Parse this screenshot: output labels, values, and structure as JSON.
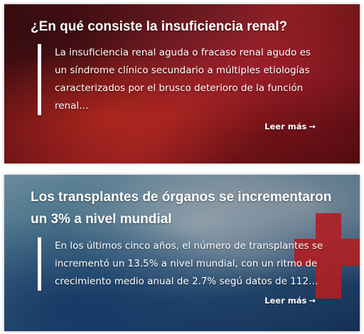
{
  "articles": [
    {
      "title": "¿En qué consiste la insuficiencia renal?",
      "excerpt": "La insuficiencia renal aguda o fracaso renal agudo es un síndrome clínico secundario a múltiples etiologías caracterizados por el brusco deterioro de la función renal…",
      "read_more": "Leer más",
      "arrow": "→",
      "image_colors": {
        "primary": "#8e1a1e",
        "accent": "#d8262a"
      }
    },
    {
      "title": "Los transplantes de órganos se incrementaron un 3% a nivel mundial",
      "excerpt": "En los últimos cinco años, el número de transplantes se incrementó un 13.5% a nivel mundial, con un ritmo de crecimiento medio anual de 2.7% segú datos de 112…",
      "read_more": "Leer más",
      "arrow": "→",
      "image_colors": {
        "primary": "#3a6a92",
        "accent": "#d8262a"
      }
    }
  ]
}
